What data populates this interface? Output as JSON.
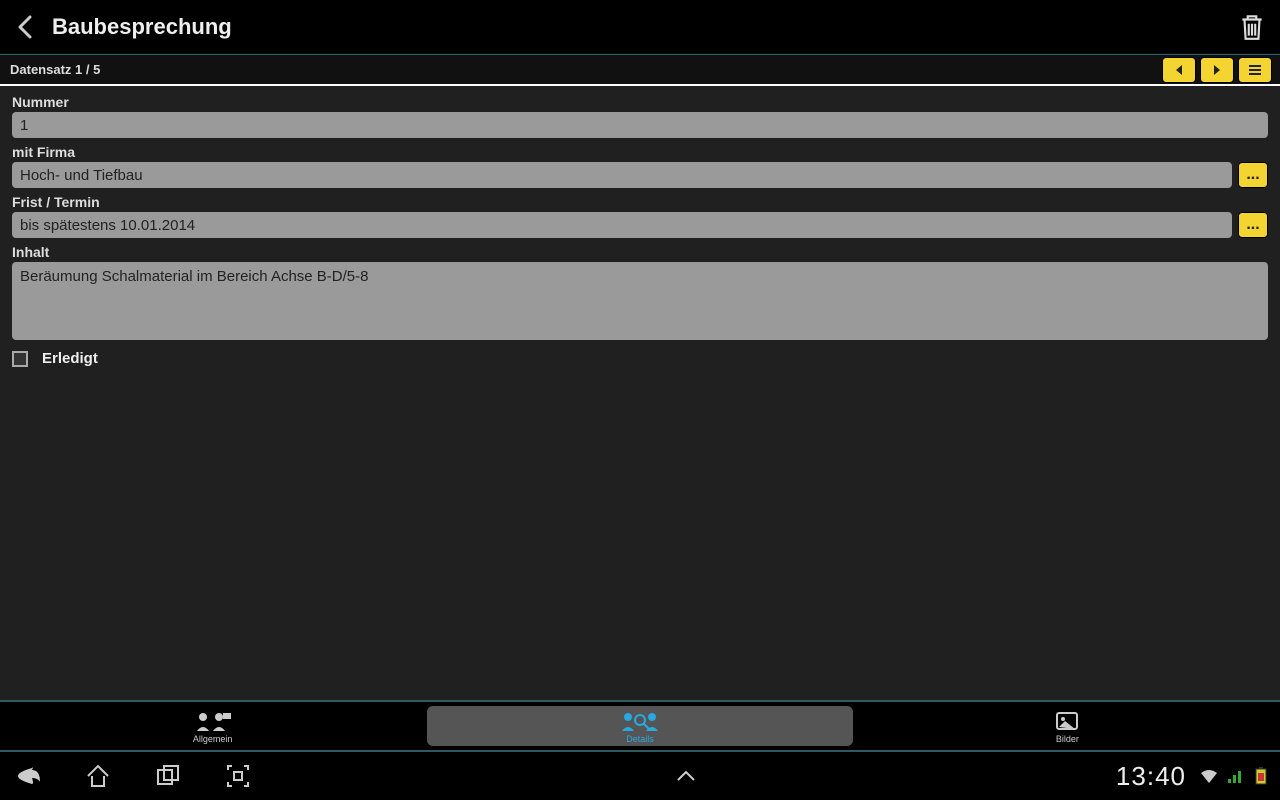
{
  "appbar": {
    "title": "Baubesprechung"
  },
  "recordbar": {
    "label": "Datensatz 1 / 5"
  },
  "form": {
    "nummer_label": "Nummer",
    "nummer_value": "1",
    "firma_label": "mit Firma",
    "firma_value": "Hoch- und Tiefbau",
    "frist_label": "Frist / Termin",
    "frist_value": "bis spätestens 10.01.2014",
    "inhalt_label": "Inhalt",
    "inhalt_value": "Beräumung Schalmaterial im Bereich Achse B-D/5-8",
    "erledigt_label": "Erledigt",
    "erledigt_checked": false,
    "picker_text": "..."
  },
  "tabs": [
    {
      "label": "Allgemein"
    },
    {
      "label": "Details"
    },
    {
      "label": "Bilder"
    }
  ],
  "sysbar": {
    "clock": "13:40"
  }
}
